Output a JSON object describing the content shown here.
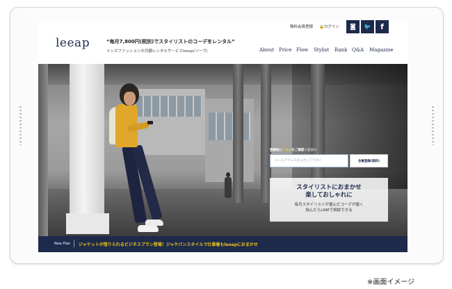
{
  "topbar": {
    "register_link": "無料会員登録",
    "login_link": "ログイン",
    "social": [
      {
        "icon": "instagram-icon",
        "glyph": "◙"
      },
      {
        "icon": "twitter-icon",
        "glyph": "🐦"
      },
      {
        "icon": "facebook-icon",
        "glyph": "f"
      }
    ]
  },
  "header": {
    "logo": "leeap",
    "catch": "“毎月7,800円(税別)でスタイリストのコーデをレンタル”",
    "subcatch": "メンズファッションの月額レンタルサービスleeap(リープ)",
    "nav": [
      "About",
      "Price",
      "Flow",
      "Stylist",
      "Rank",
      "Q&A",
      "Magazine"
    ]
  },
  "hero": {
    "register_prompt_prefix": "登録前に",
    "register_prompt_accent": "こちら",
    "register_prompt_suffix": "をご確認ください",
    "email_placeholder": "メールアドレスを入力して下さい",
    "signup_button": "会員登録(無料)",
    "promo_title_line1": "スタイリストにおまかせ",
    "promo_title_line2": "楽しておしゃれに",
    "promo_text_line1": "毎月スタイリストが選んだコーデが届く",
    "promo_text_line2": "悩んだらLINEで相談できる"
  },
  "newplan": {
    "label": "New Plan",
    "text": "ジャケットが借りられるビジネスプラン登場！ジャケパンスタイルで仕事着もleeapにおまかせ"
  },
  "caption": "※画面イメージ",
  "colors": {
    "brand_navy": "#1d2a4b",
    "accent_yellow": "#f0c419"
  }
}
